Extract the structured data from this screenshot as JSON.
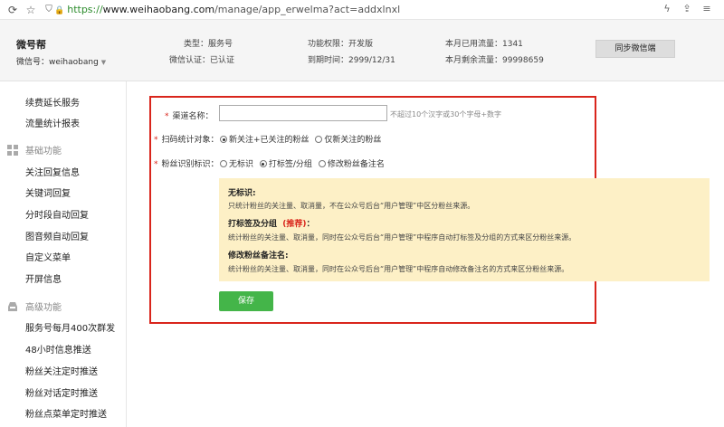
{
  "browser": {
    "url_scheme": "https://",
    "url_host": "www.weihaobang.com",
    "url_path": "/manage/app_erwelma?act=addxlnxl"
  },
  "header": {
    "brand": "微号帮",
    "account_label": "微信号：",
    "account_name": "weihaobang",
    "type": "类型：服务号",
    "verified": "微信认证：已认证",
    "permission": "功能权限：开发版",
    "expire": "到期时间：2999/12/31",
    "month_used": "本月已用流量：1341",
    "month_left": "本月剩余流量：99998659",
    "sync_button": "同步微信端"
  },
  "sidebar": {
    "top_items": [
      "续费延长服务",
      "流量统计报表"
    ],
    "basic_section": "基础功能",
    "basic_items": [
      "关注回复信息",
      "关键词回复",
      "分时段自动回复",
      "图音频自动回复",
      "自定义菜单",
      "开屏信息"
    ],
    "advanced_section": "高级功能",
    "advanced_items": [
      "服务号每月400次群发",
      "48小时信息推送",
      "粉丝关注定时推送",
      "粉丝对话定时推送",
      "粉丝点菜单定时推送"
    ]
  },
  "form": {
    "channel_label": "渠道名称：",
    "channel_value": "",
    "channel_hint": "不超过10个汉字或30个字母+数字",
    "scan_label": "扫码统计对象：",
    "scan_options": [
      "新关注+已关注的粉丝",
      "仅新关注的粉丝"
    ],
    "fan_label": "粉丝识别标识：",
    "fan_options": [
      "无标识",
      "打标签/分组",
      "修改粉丝备注名"
    ],
    "notes": {
      "none_title": "无标识:",
      "none_text": "只统计粉丝的关注量、取消量，不在公众号后台“用户管理”中区分粉丝来源。",
      "tag_title": "打标签及分组",
      "tag_rec": "(推荐)",
      "tag_colon": "：",
      "tag_text": "统计粉丝的关注量、取消量，同时在公众号后台“用户管理”中程序自动打标签及分组的方式来区分粉丝来源。",
      "remark_title": "修改粉丝备注名:",
      "remark_text": "统计粉丝的关注量、取消量，同时在公众号后台“用户管理”中程序自动修改备注名的方式来区分粉丝来源。"
    },
    "save_button": "保存"
  }
}
